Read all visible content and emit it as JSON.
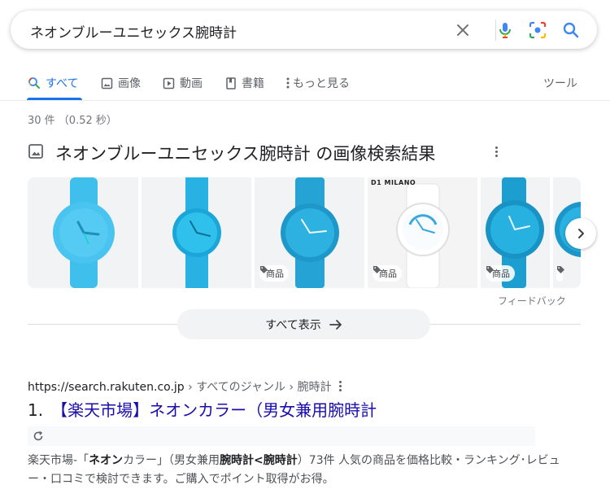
{
  "search": {
    "query": "ネオンブルーユニセックス腕時計",
    "icons": [
      "close-icon",
      "mic-icon",
      "camera-lens-icon",
      "search-icon"
    ]
  },
  "tabs": [
    {
      "label": "すべて",
      "icon": "search-icon",
      "active": true
    },
    {
      "label": "画像",
      "icon": "image-icon"
    },
    {
      "label": "動画",
      "icon": "play-icon"
    },
    {
      "label": "書籍",
      "icon": "book-icon"
    },
    {
      "label": "もっと見る",
      "icon": "more-vert-icon"
    }
  ],
  "tools_label": "ツール",
  "result_stats": "30 件 （0.52 秒）",
  "images_section": {
    "title": "ネオンブルーユニセックス腕時計 の画像検索結果",
    "product_tag": "商品",
    "brand_text": "D1 MILANO",
    "feedback": "フィードバック",
    "show_all": "すべて表示",
    "accent_color": "#1aa7d8"
  },
  "result": {
    "url": "https://search.rakuten.co.jp",
    "breadcrumbs": " › すべてのジャンル › 腕時計",
    "number": "1.",
    "title": "【楽天市場】ネオンカラー（男女兼用腕時計",
    "snippet_parts": [
      "楽天市場-「",
      "ネオン",
      "カラー」（男女兼用",
      "腕時計<腕時計",
      "）73件 人気の商品を価格比較・ランキング･レビュー・口コミで検討できます。ご購入でポイント取得がお得。"
    ]
  }
}
